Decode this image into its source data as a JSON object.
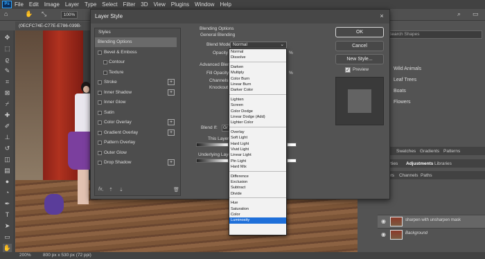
{
  "menu": [
    "File",
    "Edit",
    "Image",
    "Layer",
    "Type",
    "Select",
    "Filter",
    "3D",
    "View",
    "Plugins",
    "Window",
    "Help"
  ],
  "app_logo": "Ps",
  "options": {
    "zoom": "100%"
  },
  "document_tab": "(0ECFC74E-C77E-E786-039B-3F1395E",
  "status": {
    "zoom": "200%",
    "size": "800 px x 530 px (72 ppi)"
  },
  "dialog": {
    "title": "Layer Style",
    "styles_header": "Styles",
    "styles": [
      {
        "label": "Blending Options",
        "type": "selected"
      },
      {
        "label": "Bevel & Emboss",
        "type": "check"
      },
      {
        "label": "Contour",
        "type": "sub"
      },
      {
        "label": "Texture",
        "type": "sub"
      },
      {
        "label": "Stroke",
        "type": "check",
        "plus": true
      },
      {
        "label": "Inner Shadow",
        "type": "check",
        "plus": true
      },
      {
        "label": "Inner Glow",
        "type": "check"
      },
      {
        "label": "Satin",
        "type": "check"
      },
      {
        "label": "Color Overlay",
        "type": "check",
        "plus": true
      },
      {
        "label": "Gradient Overlay",
        "type": "check",
        "plus": true
      },
      {
        "label": "Pattern Overlay",
        "type": "check"
      },
      {
        "label": "Outer Glow",
        "type": "check"
      },
      {
        "label": "Drop Shadow",
        "type": "check",
        "plus": true
      }
    ],
    "fx_label": "fx,",
    "section_title": "Blending Options",
    "general_blending": "General Blending",
    "blend_mode_label": "Blend Mode:",
    "blend_mode_value": "Normal",
    "opacity_label": "Opacity",
    "advanced_blending": "Advanced Blendi",
    "fill_opacity_label": "Fill Opacity",
    "channels_label": "Channels",
    "knockout_label": "Knockout",
    "blend_if_label": "Blend If:",
    "blend_if_value": "Gr",
    "this_layer_label": "This Layer:",
    "underlying_layer_label": "Underlying Layer:",
    "percent": "%",
    "buttons": {
      "ok": "OK",
      "cancel": "Cancel",
      "new_style": "New Style..."
    },
    "preview_label": "Preview",
    "close_glyph": "×"
  },
  "blend_modes": [
    [
      "Normal",
      "Dissolve"
    ],
    [
      "Darken",
      "Multiply",
      "Color Burn",
      "Linear Burn",
      "Darker Color"
    ],
    [
      "Lighten",
      "Screen",
      "Color Dodge",
      "Linear Dodge (Add)",
      "Lighter Color"
    ],
    [
      "Overlay",
      "Soft Light",
      "Hard Light",
      "Vivid Light",
      "Linear Light",
      "Pin Light",
      "Hard Mix"
    ],
    [
      "Difference",
      "Exclusion",
      "Subtract",
      "Divide"
    ],
    [
      "Hue",
      "Saturation",
      "Color",
      "Luminosity"
    ]
  ],
  "selected_blend_mode": "Luminosity",
  "right_panel": {
    "search_placeholder": "Search Shapes",
    "shape_groups": [
      "Wild Animals",
      "Leaf Trees",
      "Boats",
      "Flowers"
    ],
    "tabs1": [
      "Swatches",
      "Gradients",
      "Patterns"
    ],
    "tabs2": [
      "rties",
      "Adjustments",
      "Libraries"
    ],
    "tabs3": [
      "ers",
      "Channels",
      "Paths"
    ],
    "layers": [
      {
        "name": "sharpen with unsharpen mask",
        "selected": true
      },
      {
        "name": "Background",
        "selected": false
      }
    ]
  }
}
